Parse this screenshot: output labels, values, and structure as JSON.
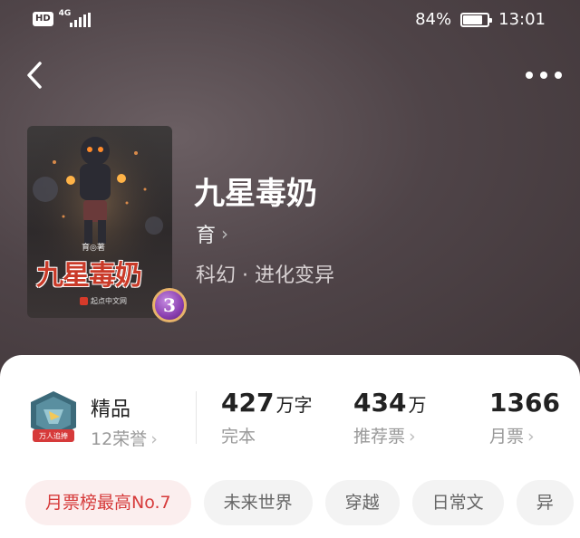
{
  "status_bar": {
    "network_badge": "HD",
    "network_type": "4G",
    "battery_percent": "84%",
    "battery_level": 0.84,
    "time": "13:01"
  },
  "nav": {
    "back_icon": "chevron-left-icon",
    "more_icon": "more-dots-icon"
  },
  "book": {
    "title": "九星毒奶",
    "author": "育",
    "genre": "科幻 · 进化变异",
    "cover_title": "九星毒奶",
    "cover_author": "育◎著",
    "cover_publisher": "起点中文网",
    "rank_badge": "3"
  },
  "honor": {
    "name": "精品",
    "count_label": "12荣誉",
    "badge_caption": "万人追捧"
  },
  "stats": {
    "words_value": "427",
    "words_unit": "万字",
    "words_label": "完本",
    "recommend_value": "434",
    "recommend_unit": "万",
    "recommend_label": "推荐票",
    "monthly_value": "1366",
    "monthly_label": "月票"
  },
  "tags": [
    "月票榜最高No.7",
    "未来世界",
    "穿越",
    "日常文",
    "异"
  ],
  "colors": {
    "header_bg": "#4f4448",
    "hot_tag_text": "#d63a3a",
    "hot_tag_bg": "#fbeeee",
    "card_bg": "#ffffff"
  }
}
